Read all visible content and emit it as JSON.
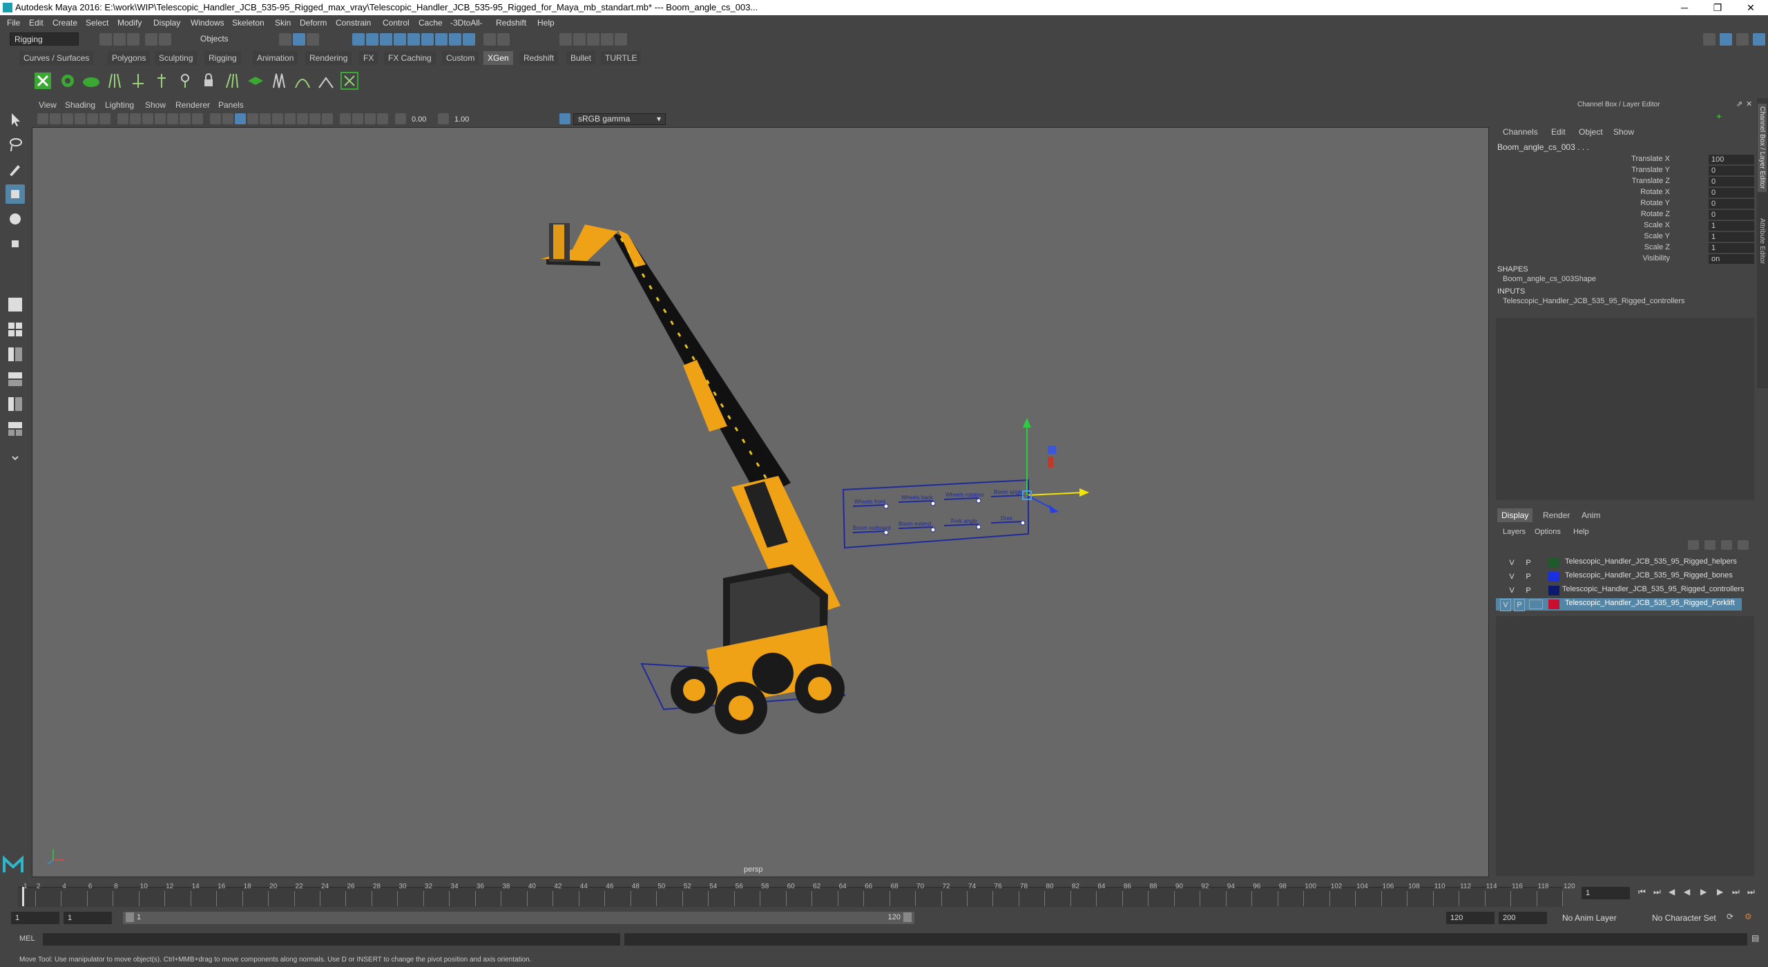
{
  "window": {
    "title": "Autodesk Maya 2016: E:\\work\\WIP\\Telescopic_Handler_JCB_535-95_Rigged_max_vray\\Telescopic_Handler_JCB_535-95_Rigged_for_Maya_mb_standart.mb*   ---   Boom_angle_cs_003...",
    "minimize": "─",
    "maximize": "❐",
    "close": "✕"
  },
  "menubar": [
    "File",
    "Edit",
    "Create",
    "Select",
    "Modify",
    "Display",
    "Windows",
    "Skeleton",
    "Skin",
    "Deform",
    "Constrain",
    "Control",
    "Cache",
    "-3DtoAll-",
    "Redshift",
    "Help"
  ],
  "status": {
    "mode": "Rigging",
    "selection_mode": "Objects"
  },
  "shelf_tabs": [
    "Curves / Surfaces",
    "Polygons",
    "Sculpting",
    "Rigging",
    "Animation",
    "Rendering",
    "FX",
    "FX Caching",
    "Custom",
    "XGen",
    "Redshift",
    "Bullet",
    "TURTLE"
  ],
  "shelf_active": "XGen",
  "viewport": {
    "menus": [
      "View",
      "Shading",
      "Lighting",
      "Show",
      "Renderer",
      "Panels"
    ],
    "exposure": "0.00",
    "gamma": "1.00",
    "color_space": "sRGB gamma",
    "camera_label": "persp",
    "ctrl_labels_top": [
      "Wheels front",
      "Wheels back",
      "Wheels rotation",
      "Boom angle"
    ],
    "ctrl_labels_bottom": [
      "Boom outboard",
      "Boom extend",
      "Fork angle",
      "Door"
    ]
  },
  "channel_box": {
    "header": "Channel Box / Layer Editor",
    "menus": [
      "Channels",
      "Edit",
      "Object",
      "Show"
    ],
    "object_name": "Boom_angle_cs_003 . . .",
    "channels": [
      {
        "label": "Translate X",
        "value": "100"
      },
      {
        "label": "Translate Y",
        "value": "0"
      },
      {
        "label": "Translate Z",
        "value": "0"
      },
      {
        "label": "Rotate X",
        "value": "0"
      },
      {
        "label": "Rotate Y",
        "value": "0"
      },
      {
        "label": "Rotate Z",
        "value": "0"
      },
      {
        "label": "Scale X",
        "value": "1"
      },
      {
        "label": "Scale Y",
        "value": "1"
      },
      {
        "label": "Scale Z",
        "value": "1"
      },
      {
        "label": "Visibility",
        "value": "on"
      }
    ],
    "shapes_header": "SHAPES",
    "shape_name": "Boom_angle_cs_003Shape",
    "inputs_header": "INPUTS",
    "input_name": "Telescopic_Handler_JCB_535_95_Rigged_controllers"
  },
  "side_tabs": [
    "Channel Box / Layer Editor",
    "Attribute Editor"
  ],
  "layer_editor": {
    "tabs": [
      "Display",
      "Render",
      "Anim"
    ],
    "menus": [
      "Layers",
      "Options",
      "Help"
    ],
    "layers": [
      {
        "v": "V",
        "p": "P",
        "name": "Telescopic_Handler_JCB_535_95_Rigged_helpers",
        "color": "#1f5a2a",
        "selected": false
      },
      {
        "v": "V",
        "p": "P",
        "name": "Telescopic_Handler_JCB_535_95_Rigged_bones",
        "color": "#1a2fe0",
        "selected": false
      },
      {
        "v": "V",
        "p": "P",
        "name": "Telescopic_Handler_JCB_535_95_Rigged_controllers",
        "color": "#0c1a6e",
        "selected": false
      },
      {
        "v": "V",
        "p": "P",
        "name": "Telescopic_Handler_JCB_535_95_Rigged_Forklift",
        "color": "#c8102e",
        "selected": true
      }
    ]
  },
  "timeline": {
    "ticks": [
      "1",
      "2",
      "4",
      "6",
      "8",
      "10",
      "12",
      "14",
      "16",
      "18",
      "20",
      "22",
      "24",
      "26",
      "28",
      "30",
      "32",
      "34",
      "36",
      "38",
      "40",
      "42",
      "44",
      "46",
      "48",
      "50",
      "52",
      "54",
      "56",
      "58",
      "60",
      "62",
      "64",
      "66",
      "68",
      "70",
      "72",
      "74",
      "76",
      "78",
      "80",
      "82",
      "84",
      "86",
      "88",
      "90",
      "92",
      "94",
      "96",
      "98",
      "100",
      "102",
      "104",
      "106",
      "108",
      "110",
      "112",
      "114",
      "116",
      "118",
      "120"
    ],
    "current_frame": "1"
  },
  "range": {
    "start": "1",
    "playback_start": "1",
    "slider_start": "1",
    "slider_end": "120",
    "playback_end": "120",
    "end": "200",
    "anim_layer": "No Anim Layer",
    "character_set": "No Character Set"
  },
  "command": {
    "label": "MEL"
  },
  "help_line": "Move Tool: Use manipulator to move object(s). Ctrl+MMB+drag to move components along normals. Use D or INSERT to change the pivot position and axis orientation."
}
